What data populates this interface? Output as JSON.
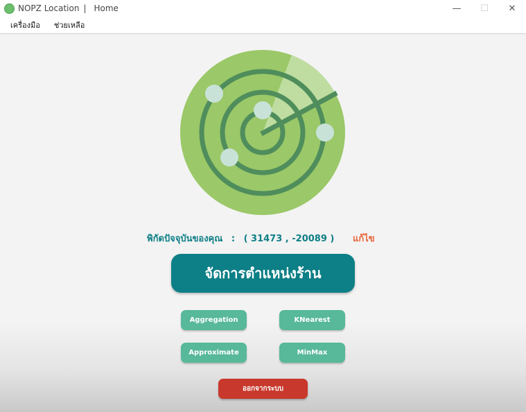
{
  "window": {
    "app_name": "NOPZ Location",
    "separator": "|",
    "page_name": "Home",
    "minimize": "—",
    "maximize": "☐",
    "close": "✕"
  },
  "menu": {
    "items": [
      {
        "label": "เครื่องมือ"
      },
      {
        "label": "ช่วยเหลือ"
      }
    ]
  },
  "radar": {
    "icon": "radar-icon",
    "colors": {
      "outer": "#9bc868",
      "ring": "#4f8d5c",
      "sweep": "#bfdda0",
      "blip": "#c9e2d8"
    }
  },
  "location": {
    "label": "พิกัดปัจจุบันของคุณ",
    "colon": ":",
    "value": "( 31473 , -20089 )",
    "edit_label": "แก้ไข"
  },
  "actions": {
    "manage_store": "จัดการตำแหน่งร้าน",
    "aggregation": "Aggregation",
    "knearest": "KNearest",
    "approximate": "Approximate",
    "minmax": "MinMax",
    "logout": "ออกจากระบบ"
  },
  "colors": {
    "accent": "#0d7f86",
    "secondary": "#57b89a",
    "danger": "#c8382c",
    "edit": "#e8643a"
  }
}
